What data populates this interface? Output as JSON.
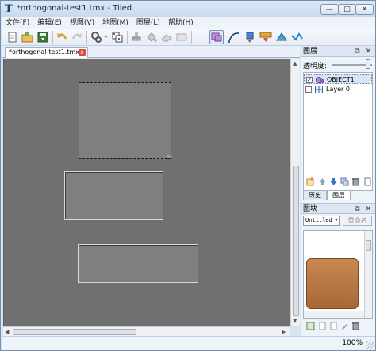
{
  "window": {
    "title": "*orthogonal-test1.tmx - Tiled",
    "app_icon": "T",
    "buttons": {
      "minimize": "—",
      "maximize": "□",
      "close": "✕"
    }
  },
  "menu": [
    "文件(F)",
    "编辑(E)",
    "视图(V)",
    "地图(M)",
    "图层(L)",
    "帮助(H)"
  ],
  "toolbar": {
    "icons": [
      "new-file-icon",
      "open-file-icon",
      "save-icon",
      "undo-icon",
      "redo-icon",
      "command-icon",
      "random-icon",
      "stamp-brush-icon",
      "bucket-fill-icon",
      "eraser-icon",
      "rectangle-select-icon",
      "select-objects-icon",
      "edit-polygons-icon",
      "insert-rectangle-icon",
      "insert-tile-icon",
      "insert-polygon-icon",
      "insert-polyline-icon"
    ],
    "active_tool": "select-objects-icon"
  },
  "map_tab": {
    "label": "*orthogonal-test1.tmx",
    "close": "x"
  },
  "layers_panel": {
    "title": "图层",
    "title_buttons": "⧉ ✕",
    "opacity_label": "透明度:",
    "opacity_value": 1.0,
    "layers": [
      {
        "name": "OBJECT1",
        "visible": true,
        "checkmark": "✓",
        "type": "object-layer-icon",
        "selected": true
      },
      {
        "name": "Layer 0",
        "visible": false,
        "checkmark": "",
        "type": "tile-layer-icon",
        "selected": false
      }
    ],
    "tabs": [
      "历史",
      "图层"
    ],
    "active_tab": "图层"
  },
  "tileset_panel": {
    "title": "图块",
    "title_buttons": "⧉ ✕",
    "tileset_name": "Untitled",
    "dropdown_arrow": "▾",
    "rename_label": "重命名"
  },
  "status": {
    "zoom": "100%"
  },
  "colors": {
    "map_background": "#707070",
    "object_fill": "#7f7f7f",
    "tile_fill": "#b57542",
    "chrome": "#d8e4f2"
  }
}
